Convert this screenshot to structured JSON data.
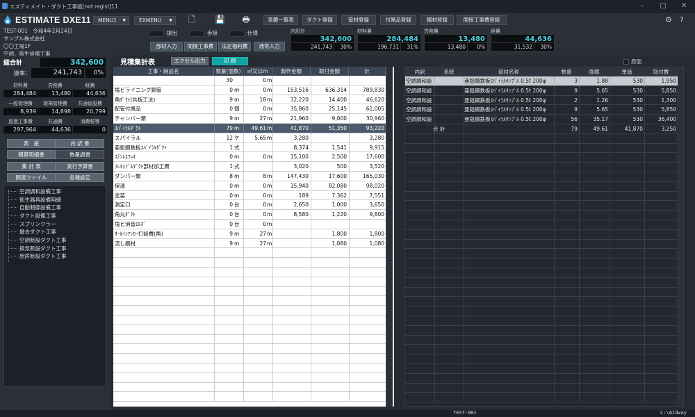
{
  "window": {
    "title": "エスティメイト・ダクト工事版[not regist]11"
  },
  "app": {
    "title": "ESTIMATE DXE11",
    "menu1": "MENU1",
    "exmenu": "EXMENU"
  },
  "project": {
    "code": "TEST-001",
    "date": "令和4年2月24日",
    "client": "サンプル株式会社",
    "site": "〇〇工場1F",
    "work": "空調、衛生設備工事"
  },
  "toolbar": {
    "buttons": [
      "見積一覧表",
      "ダクト登録",
      "管材登録",
      "付属品登録",
      "鋼材登録",
      "間接工事費登録"
    ]
  },
  "checks": [
    "提出",
    "歩掛",
    "仕様"
  ],
  "modebtns": [
    "部材入力",
    "間接工事費",
    "法定福利費",
    "通常入力"
  ],
  "summary": [
    {
      "label": "内訳計",
      "value": "342,600",
      "sub": "241,743",
      "pct": "30%"
    },
    {
      "label": "材料費",
      "value": "284,484",
      "sub": "196,731",
      "pct": "31%"
    },
    {
      "label": "労務費",
      "value": "13,480",
      "sub": "13,480",
      "pct": "0%"
    },
    {
      "label": "経費",
      "value": "44,636",
      "sub": "31,532",
      "pct": "30%"
    }
  ],
  "left": {
    "total_label": "総合計",
    "total_value": "342,600",
    "rate_label": "掛率：",
    "rate_value": "241,743",
    "rate_pct": "0%",
    "grid1": {
      "labels": [
        "材料費",
        "労務費",
        "経費"
      ],
      "values": [
        "284,484",
        "13,480",
        "44,636"
      ]
    },
    "grid2": {
      "labels": [
        "一般管理費",
        "現場管理費",
        "共通仮設費"
      ],
      "values": [
        "8,939",
        "14,898",
        "20,799"
      ]
    },
    "grid3": {
      "labels": [
        "直接工事費",
        "共通費",
        "消費税等"
      ],
      "values": [
        "297,964",
        "44,636",
        "0"
      ]
    },
    "buttons": [
      "表　紙",
      "内 訳 書",
      "積算明細書",
      "数量調書",
      "集 計 表",
      "実行予算書",
      "関連ファイル",
      "各種設定"
    ],
    "tree": [
      "空調調和設備工事",
      "衛生器具設備明細",
      "自動制御設備工事",
      "ダクト設備工事",
      "スプリンクラー",
      "撤去ダクト工事",
      "空調新設ダクト工事",
      "換気新設ダクト工事",
      "厨房新設ダクト工事"
    ]
  },
  "main": {
    "title": "見積集計表",
    "excel": "エクセル出力",
    "print": "印 刷",
    "columns": [
      "工事・納品名",
      "数量(個数)",
      "㎡又はm",
      "製作金額",
      "取付金額",
      "計"
    ],
    "rows": [
      {
        "name": "",
        "qty": "30",
        "u": "",
        "m2": "0",
        "mu": "m",
        "make": "",
        "inst": "",
        "total": ""
      },
      {
        "name": "塩ビライニング鋼管",
        "qty": "0",
        "u": "m",
        "m2": "0",
        "mu": "m",
        "make": "153,516",
        "inst": "636,314",
        "total": "789,830"
      },
      {
        "name": "角ﾀﾞｸﾄ(共板工法)",
        "qty": "9",
        "u": "m",
        "m2": "18",
        "mu": "m",
        "make": "32,220",
        "inst": "14,400",
        "total": "46,620"
      },
      {
        "name": "配管付属品",
        "qty": "0",
        "u": "個",
        "m2": "0",
        "mu": "m",
        "make": "35,860",
        "inst": "25,145",
        "total": "61,005"
      },
      {
        "name": "チャンバー類",
        "qty": "9",
        "u": "m",
        "m2": "27",
        "mu": "m",
        "make": "21,960",
        "inst": "9,000",
        "total": "30,960"
      },
      {
        "name": "ｽﾊﾟｲﾗﾙﾀﾞｸﾄ",
        "qty": "79",
        "u": "m",
        "m2": "49.61",
        "mu": "m",
        "make": "41,870",
        "inst": "51,350",
        "total": "93,220",
        "sel": true
      },
      {
        "name": "スパイラル",
        "qty": "12",
        "u": "ケ",
        "m2": "5.65",
        "mu": "m",
        "make": "3,280",
        "inst": "",
        "total": "3,280"
      },
      {
        "name": "亜鉛鋼鉄板ｽﾊﾟｲﾗﾙﾀﾞｸﾄ",
        "qty": "1",
        "u": "式",
        "m2": "",
        "mu": "",
        "make": "8,374",
        "inst": "1,541",
        "total": "9,915"
      },
      {
        "name": "ｽﾃﾝﾚｽﾌﾚｷ",
        "qty": "0",
        "u": "m",
        "m2": "0",
        "mu": "m",
        "make": "15,100",
        "inst": "2,500",
        "total": "17,600"
      },
      {
        "name": "ﾌﾚｷｼﾌﾞﾙﾀﾞｸﾄ部材加工費",
        "qty": "1",
        "u": "式",
        "m2": "",
        "mu": "",
        "make": "3,020",
        "inst": "500",
        "total": "3,520"
      },
      {
        "name": "ダンパー類",
        "qty": "8",
        "u": "m",
        "m2": "8",
        "mu": "m",
        "make": "147,430",
        "inst": "17,600",
        "total": "165,030"
      },
      {
        "name": "保温",
        "qty": "0",
        "u": "m",
        "m2": "0",
        "mu": "m",
        "make": "15,940",
        "inst": "82,080",
        "total": "98,020"
      },
      {
        "name": "塗装",
        "qty": "0",
        "u": "m",
        "m2": "0",
        "mu": "m",
        "make": "189",
        "inst": "7,362",
        "total": "7,551"
      },
      {
        "name": "測定口",
        "qty": "0",
        "u": "台",
        "m2": "0",
        "mu": "m",
        "make": "2,650",
        "inst": "1,000",
        "total": "3,650"
      },
      {
        "name": "角丸ﾀﾞｸﾄ",
        "qty": "0",
        "u": "台",
        "m2": "0",
        "mu": "m",
        "make": "8,580",
        "inst": "1,220",
        "total": "9,800"
      },
      {
        "name": "塩ビ消音ｴﾙﾎﾞ",
        "qty": "0",
        "u": "台",
        "m2": "0",
        "mu": "m",
        "make": "",
        "inst": "",
        "total": ""
      },
      {
        "name": "ｵｰﾙｲﾝｱﾝｶｰ打設費(角)",
        "qty": "9",
        "u": "m",
        "m2": "27",
        "mu": "m",
        "make": "",
        "inst": "1,800",
        "total": "1,800"
      },
      {
        "name": "流し鋼材",
        "qty": "9",
        "u": "m",
        "m2": "27",
        "mu": "m",
        "make": "",
        "inst": "1,080",
        "total": "1,080"
      }
    ]
  },
  "right": {
    "genka": "原価",
    "columns": [
      "内訳",
      "系統",
      "部材名称",
      "数量",
      "面積",
      "単価",
      "取付費"
    ],
    "rows": [
      {
        "a": "空調調和設",
        "b": "",
        "name": "亜鉛鋼鉄板ｽﾊﾟｲﾗﾙｻﾝﾌﾟﾙ 0.5t 200φ",
        "qty": "3",
        "area": "1.88",
        "price": "530",
        "fee": "1,950",
        "sel": true
      },
      {
        "a": "空調調和設",
        "b": "",
        "name": "亜鉛鋼鉄板ｽﾊﾟｲﾗﾙｻﾝﾌﾟﾙ 0.5t 200φ",
        "qty": "9",
        "area": "5.65",
        "price": "530",
        "fee": "5,850"
      },
      {
        "a": "空調調和設",
        "b": "",
        "name": "亜鉛鋼鉄板ｽﾊﾟｲﾗﾙｻﾝﾌﾟﾙ 0.5t 200φ",
        "qty": "2",
        "area": "1.26",
        "price": "530",
        "fee": "1,300"
      },
      {
        "a": "空調調和設",
        "b": "",
        "name": "亜鉛鋼鉄板ｽﾊﾟｲﾗﾙｻﾝﾌﾟﾙ 0.5t 200φ",
        "qty": "9",
        "area": "5.65",
        "price": "530",
        "fee": "5,850"
      },
      {
        "a": "空調調和設",
        "b": "",
        "name": "亜鉛鋼鉄板ｽﾊﾟｲﾗﾙｻﾝﾌﾟﾙ 0.5t 200φ",
        "qty": "56",
        "area": "35.17",
        "price": "530",
        "fee": "36,400"
      }
    ],
    "total": {
      "label": "合 計",
      "qty": "79",
      "area": "49.61",
      "price": "41,870",
      "fee": "3,250"
    }
  },
  "status": {
    "code": "TEST-001",
    "path": "C:\\midway"
  }
}
